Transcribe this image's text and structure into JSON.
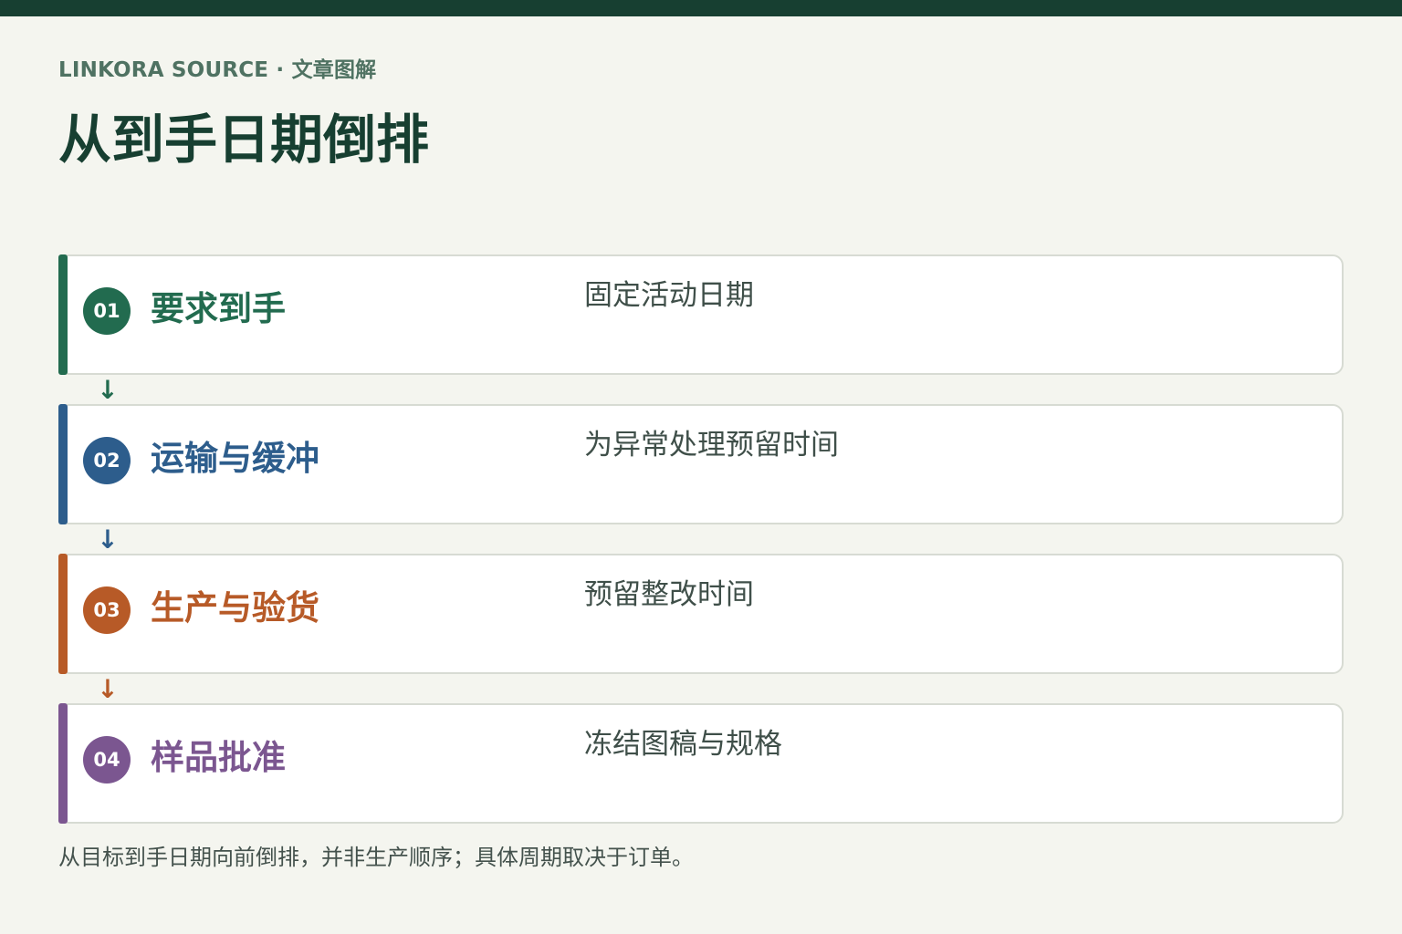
{
  "header": {
    "kicker": "LINKORA SOURCE · 文章图解",
    "title": "从到手日期倒排"
  },
  "steps": [
    {
      "number": "01",
      "title": "要求到手",
      "description": "固定活动日期",
      "color": "#226b4f"
    },
    {
      "number": "02",
      "title": "运输与缓冲",
      "description": "为异常处理预留时间",
      "color": "#2d5d8c"
    },
    {
      "number": "03",
      "title": "生产与验货",
      "description": "预留整改时间",
      "color": "#b75a27"
    },
    {
      "number": "04",
      "title": "样品批准",
      "description": "冻结图稿与规格",
      "color": "#7b5690"
    }
  ],
  "connectors": [
    {
      "icon": "down-arrow-icon",
      "glyph": "↓"
    },
    {
      "icon": "down-arrow-icon",
      "glyph": "↓"
    },
    {
      "icon": "down-arrow-icon",
      "glyph": "↓"
    }
  ],
  "footnote": "从目标到手日期向前倒排，并非生产顺序；具体周期取决于订单。"
}
